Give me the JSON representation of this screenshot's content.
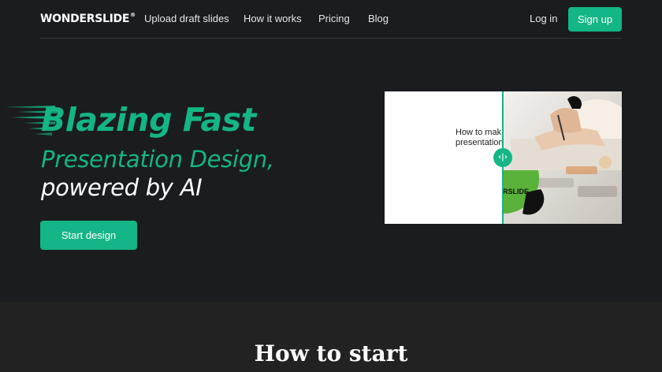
{
  "nav": {
    "logo": "WONDERSLIDE",
    "logo_mark": "®",
    "links": [
      "Upload draft slides",
      "How it works",
      "Pricing",
      "Blog"
    ],
    "login": "Log in",
    "signup": "Sign up"
  },
  "hero": {
    "title_line1": "Blazing Fast",
    "title_line2": "Presentation Design,",
    "title_line3": "powered by AI",
    "cta": "Start design"
  },
  "compare": {
    "before_title_line1": "How to mak",
    "before_title_line2": "presentation",
    "after_brand": "RSLIDE",
    "handle_glyph": "‹|›",
    "handle_icon": "compare-arrows-icon"
  },
  "section": {
    "title": "How to start"
  },
  "colors": {
    "accent": "#14b586",
    "background": "#1b1c20",
    "section_background": "#222222"
  }
}
